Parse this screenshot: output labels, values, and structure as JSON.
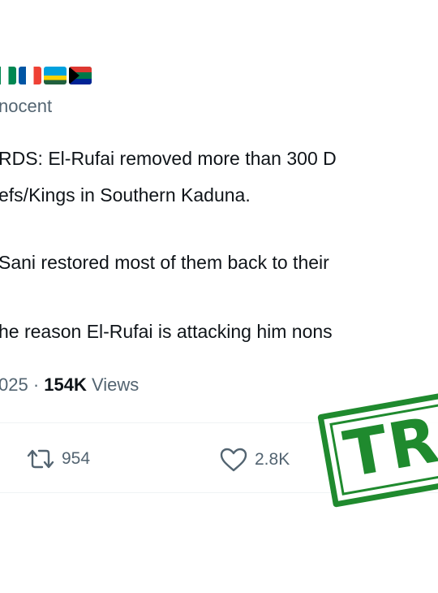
{
  "header": {
    "flags": [
      "nigeria-flag",
      "france-flag",
      "rwanda-flag",
      "south-africa-flag"
    ],
    "handle": "nocent"
  },
  "tweet": {
    "lines": [
      "RDS: El-Rufai removed more than 300 D",
      "efs/Kings in Southern Kaduna.",
      "Sani restored most of them back to their",
      "he reason El-Rufai is attacking him nons"
    ]
  },
  "meta": {
    "date": "025",
    "separator": "·",
    "views_count": "154K",
    "views_label": "Views"
  },
  "actions": {
    "retweets": "954",
    "likes": "2.8K"
  },
  "stamp": {
    "text": "TR",
    "color": "#1f8a2e"
  }
}
